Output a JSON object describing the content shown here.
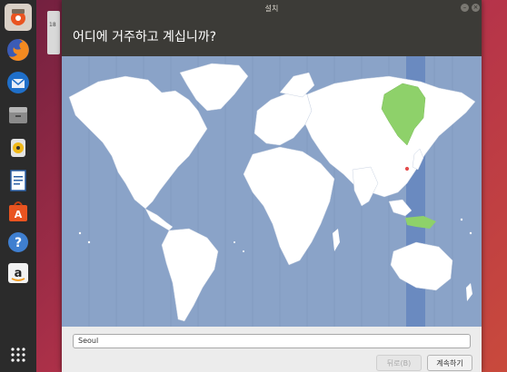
{
  "window": {
    "title": "설치",
    "question": "어디에 거주하고 계십니까?"
  },
  "timezone": {
    "value": "Seoul",
    "selected_zone_color": "#8ed16a",
    "highlight_band_color": "#6a8ac0"
  },
  "buttons": {
    "back": "뒤로(B)",
    "continue": "계속하기"
  },
  "dock": {
    "items": [
      "ubuntu-installer-icon",
      "firefox-icon",
      "thunderbird-icon",
      "files-icon",
      "rhythmbox-icon",
      "libreoffice-writer-icon",
      "software-center-icon",
      "help-icon",
      "amazon-icon",
      "show-apps-icon"
    ]
  },
  "desktop": {
    "file_label": "18"
  },
  "colors": {
    "ocean": "#8aa3c8",
    "land": "#ffffff",
    "header": "#3c3b37"
  }
}
